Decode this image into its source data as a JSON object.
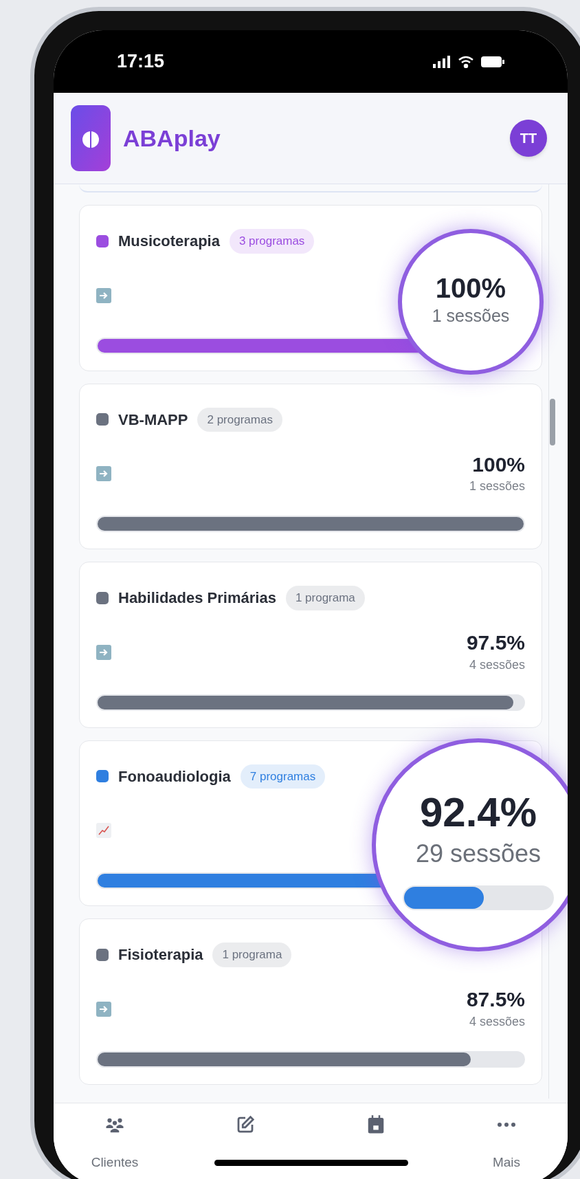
{
  "status_bar": {
    "time": "17:15"
  },
  "header": {
    "app_name": "ABAplay",
    "avatar": "TT"
  },
  "cards": [
    {
      "kind": "highlight",
      "name": "Musicoterapia",
      "badge": "3 programas",
      "color": "#9b4de0",
      "level": 1.0,
      "magnifier": {
        "percent": "100%",
        "sessions": "1 sessões"
      }
    },
    {
      "kind": "standard",
      "name": "VB-MAPP",
      "badge": "2 programas",
      "color": "#6b7280",
      "level": 1.0,
      "percent": "100%",
      "sessions": "1 sessões"
    },
    {
      "kind": "standard",
      "name": "Habilidades Primárias",
      "badge": "1 programa",
      "color": "#6b7280",
      "level": 0.975,
      "percent": "97.5%",
      "sessions": "4 sessões"
    },
    {
      "kind": "spotlight",
      "name": "Fonoaudiologia",
      "badge": "7 programas",
      "color": "#2f7fe0",
      "level": 0.924,
      "magnifier": {
        "percent": "92.4%",
        "sessions": "29 sessões"
      }
    },
    {
      "kind": "standard",
      "name": "Fisioterapia",
      "badge": "1 programa",
      "color": "#6b7280",
      "level": 0.875,
      "percent": "87.5%",
      "sessions": "4 sessões"
    }
  ],
  "nav": [
    {
      "kind": "clients",
      "label": "Clientes"
    },
    {
      "kind": "edit"
    },
    {
      "kind": "calendar"
    },
    {
      "kind": "more",
      "label": "Mais"
    }
  ]
}
